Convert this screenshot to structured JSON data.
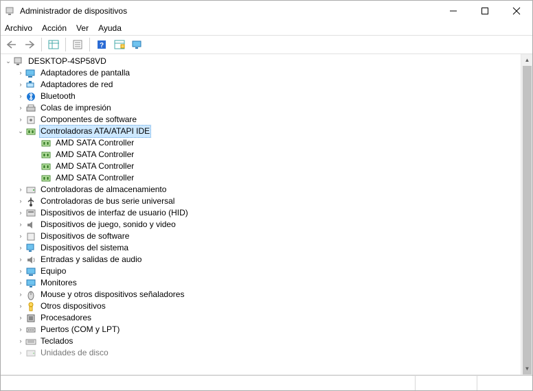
{
  "title": "Administrador de dispositivos",
  "menu": {
    "file": "Archivo",
    "action": "Acción",
    "view": "Ver",
    "help": "Ayuda"
  },
  "tree": {
    "root": "DESKTOP-4SP58VD",
    "cat": {
      "display": "Adaptadores de pantalla",
      "network": "Adaptadores de red",
      "bluetooth": "Bluetooth",
      "printq": "Colas de impresión",
      "swcomp": "Componentes de software",
      "ataatapi": "Controladoras ATA/ATAPI IDE",
      "storage": "Controladoras de almacenamiento",
      "usb": "Controladoras de bus serie universal",
      "hid": "Dispositivos de interfaz de usuario (HID)",
      "game": "Dispositivos de juego, sonido y video",
      "swdev": "Dispositivos de software",
      "system": "Dispositivos del sistema",
      "audio": "Entradas y salidas de audio",
      "computer": "Equipo",
      "monitor": "Monitores",
      "mouse": "Mouse y otros dispositivos señaladores",
      "other": "Otros dispositivos",
      "cpu": "Procesadores",
      "ports": "Puertos (COM y LPT)",
      "keyboard": "Teclados",
      "disk": "Unidades de disco"
    },
    "ata_children": [
      "AMD SATA Controller",
      "AMD SATA Controller",
      "AMD SATA Controller",
      "AMD SATA Controller"
    ]
  }
}
